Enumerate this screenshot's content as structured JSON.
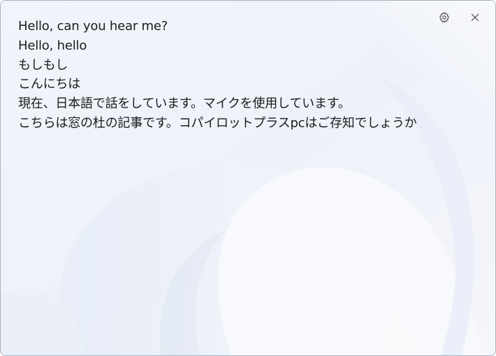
{
  "titlebar": {
    "settings_icon": "gear-icon",
    "close_icon": "close-icon"
  },
  "transcript": {
    "lines": [
      "Hello, can you hear me?",
      "Hello, hello",
      "もしもし",
      "こんにちは",
      "現在、日本語で話をしています。マイクを使用しています。",
      "こちらは窓の杜の記事です。コパイロットプラスpcはご存知でしょうか"
    ]
  },
  "colors": {
    "text": "#1b1b1b",
    "background": "#f2f4fa",
    "wallpaper_accent": "#dfe7f5"
  }
}
